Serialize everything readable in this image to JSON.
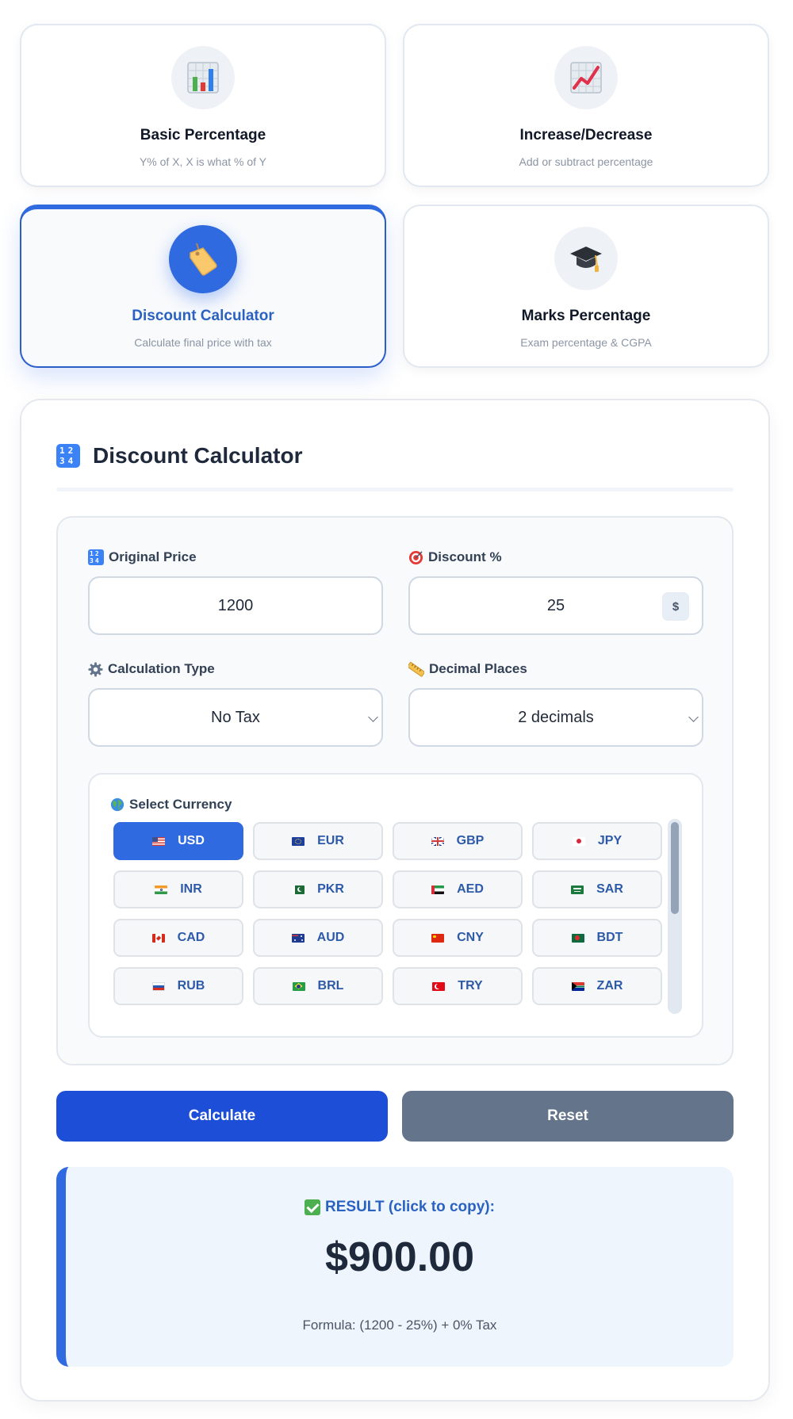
{
  "modes": [
    {
      "title": "Basic Percentage",
      "subtitle": "Y% of X, X is what % of Y",
      "icon": "bar-chart-icon"
    },
    {
      "title": "Increase/Decrease",
      "subtitle": "Add or subtract percentage",
      "icon": "trending-up-icon"
    },
    {
      "title": "Discount Calculator",
      "subtitle": "Calculate final price with tax",
      "icon": "price-tag-icon",
      "active": true
    },
    {
      "title": "Marks Percentage",
      "subtitle": "Exam percentage & CGPA",
      "icon": "graduation-cap-icon"
    }
  ],
  "panel": {
    "title": "Discount Calculator",
    "title_icon": "numbers-1234-icon"
  },
  "form": {
    "original_price_label": "Original Price",
    "original_price_value": "1200",
    "discount_label": "Discount %",
    "discount_value": "25",
    "currency_symbol": "$",
    "calc_type_label": "Calculation Type",
    "calc_type_value": "No Tax",
    "decimal_label": "Decimal Places",
    "decimal_value": "2 decimals"
  },
  "currency": {
    "label": "Select Currency",
    "selected": "USD",
    "options": [
      "USD",
      "EUR",
      "GBP",
      "JPY",
      "INR",
      "PKR",
      "AED",
      "SAR",
      "CAD",
      "AUD",
      "CNY",
      "BDT",
      "RUB",
      "BRL",
      "TRY",
      "ZAR"
    ]
  },
  "buttons": {
    "calculate": "Calculate",
    "reset": "Reset"
  },
  "result": {
    "label": "RESULT (click to copy):",
    "value": "$900.00",
    "formula": "Formula: (1200 - 25%) + 0% Tax"
  },
  "colors": {
    "accent": "#2f6ae0",
    "calculate_button": "#1d4ed8",
    "reset_button": "#64748b",
    "result_background": "#eef5fd"
  }
}
